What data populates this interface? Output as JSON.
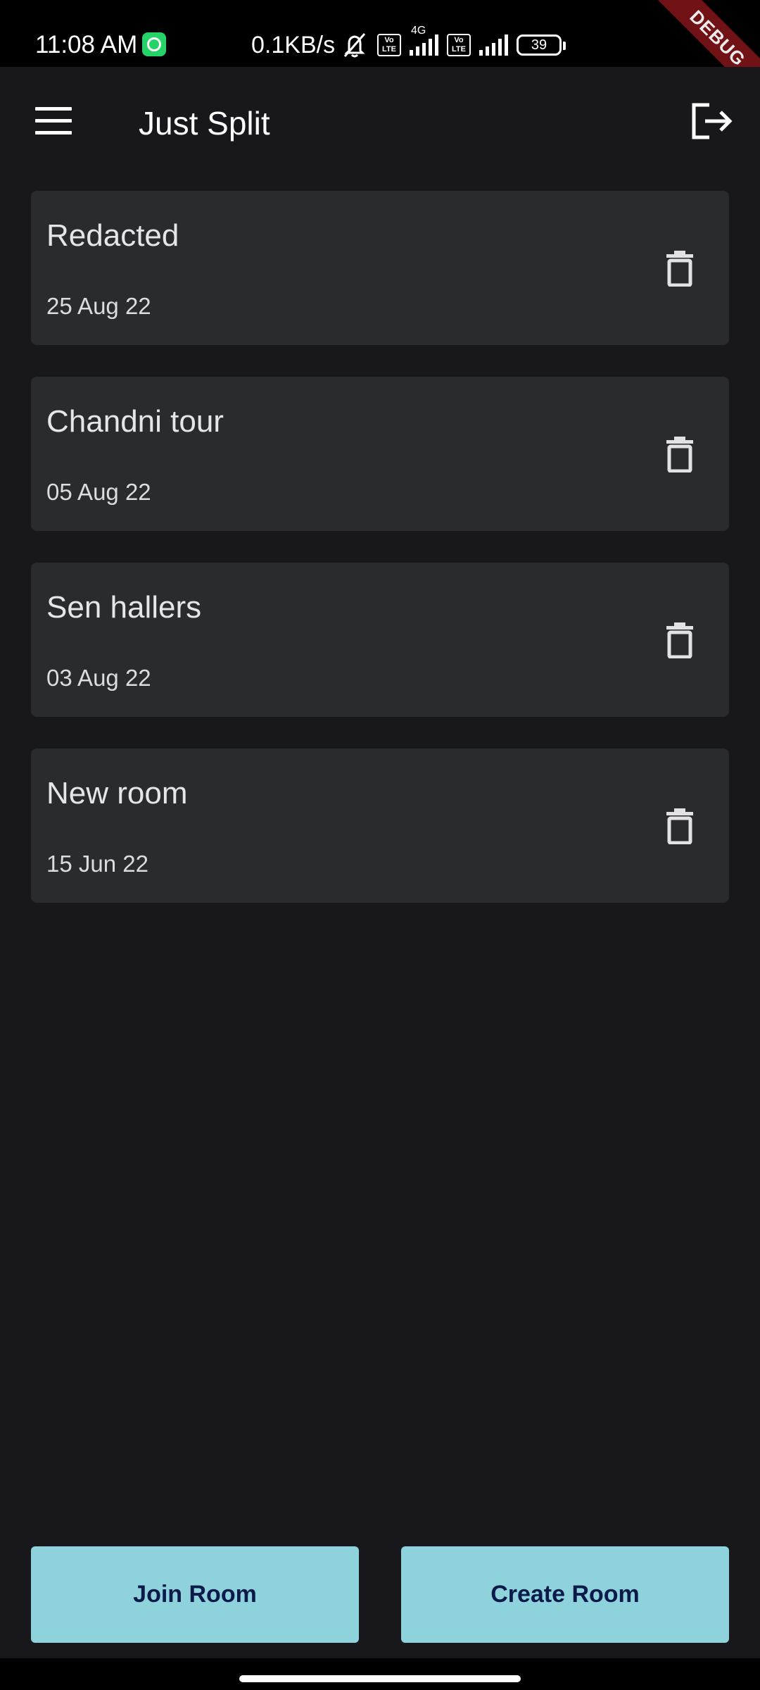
{
  "status_bar": {
    "time": "11:08 AM",
    "net_speed": "0.1KB/s",
    "volte_label": "Vo LTE",
    "network_type": "4G",
    "battery": "39",
    "debug_label": "DEBUG"
  },
  "app_bar": {
    "title": "Just Split",
    "menu_icon": "menu-icon",
    "logout_icon": "logout-icon"
  },
  "rooms": [
    {
      "name": "Redacted",
      "date": "25 Aug 22"
    },
    {
      "name": "Chandni tour",
      "date": "05 Aug 22"
    },
    {
      "name": "Sen hallers",
      "date": "03 Aug 22"
    },
    {
      "name": "New room",
      "date": "15 Jun 22"
    }
  ],
  "actions": {
    "join_label": "Join Room",
    "create_label": "Create Room"
  },
  "colors": {
    "background": "#18181c",
    "card": "#2a2b2e",
    "button": "#8ed3dc",
    "button_text": "#0b1a4a"
  }
}
